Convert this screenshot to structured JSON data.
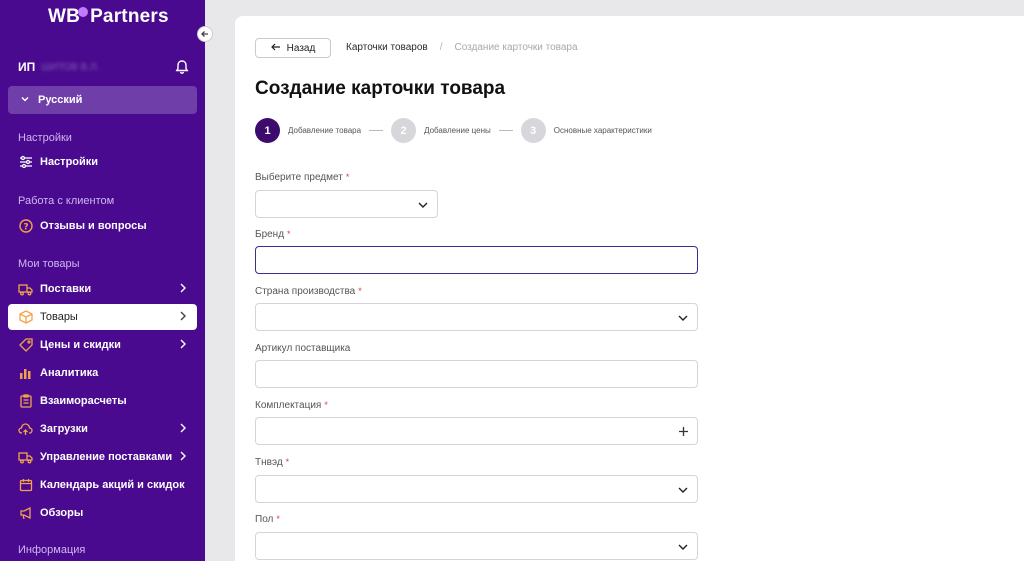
{
  "sidebar": {
    "logo_wb": "WB",
    "logo_partners": "Partners",
    "user_prefix": "ИП",
    "user_name_blurred": "ШИТОВ В.Л.",
    "language": "Русский",
    "sections": {
      "settings": "Настройки",
      "client_work": "Работа с клиентом",
      "my_goods": "Мои товары",
      "info": "Информация"
    },
    "items": {
      "settings": "Настройки",
      "reviews": "Отзывы и вопросы",
      "supplies": "Поставки",
      "goods": "Товары",
      "prices": "Цены и скидки",
      "analytics": "Аналитика",
      "settlements": "Взаиморасчеты",
      "uploads": "Загрузки",
      "supply_management": "Управление поставками",
      "calendar": "Календарь акций и скидок",
      "reviews_overview": "Обзоры"
    }
  },
  "header": {
    "back_label": "Назад",
    "breadcrumb": {
      "link": "Карточки товаров",
      "separator": "/",
      "current": "Создание карточки товара"
    }
  },
  "main": {
    "title": "Создание карточки товара",
    "steps": [
      {
        "number": "1",
        "label": "Добавление товара"
      },
      {
        "number": "2",
        "label": "Добавление цены"
      },
      {
        "number": "3",
        "label": "Основные характеристики"
      }
    ],
    "fields": {
      "subject_label": "Выберите предмет",
      "brand_label": "Бренд",
      "country_label": "Страна производства",
      "article_label": "Артикул поставщика",
      "kit_label": "Комплектация",
      "tnved_label": "Тнвэд",
      "gender_label": "Пол",
      "required_mark": "*"
    }
  },
  "colors": {
    "sidebar_bg": "#4a0a8f",
    "accent_step": "#3d0a6e",
    "required": "#e53b3b"
  }
}
